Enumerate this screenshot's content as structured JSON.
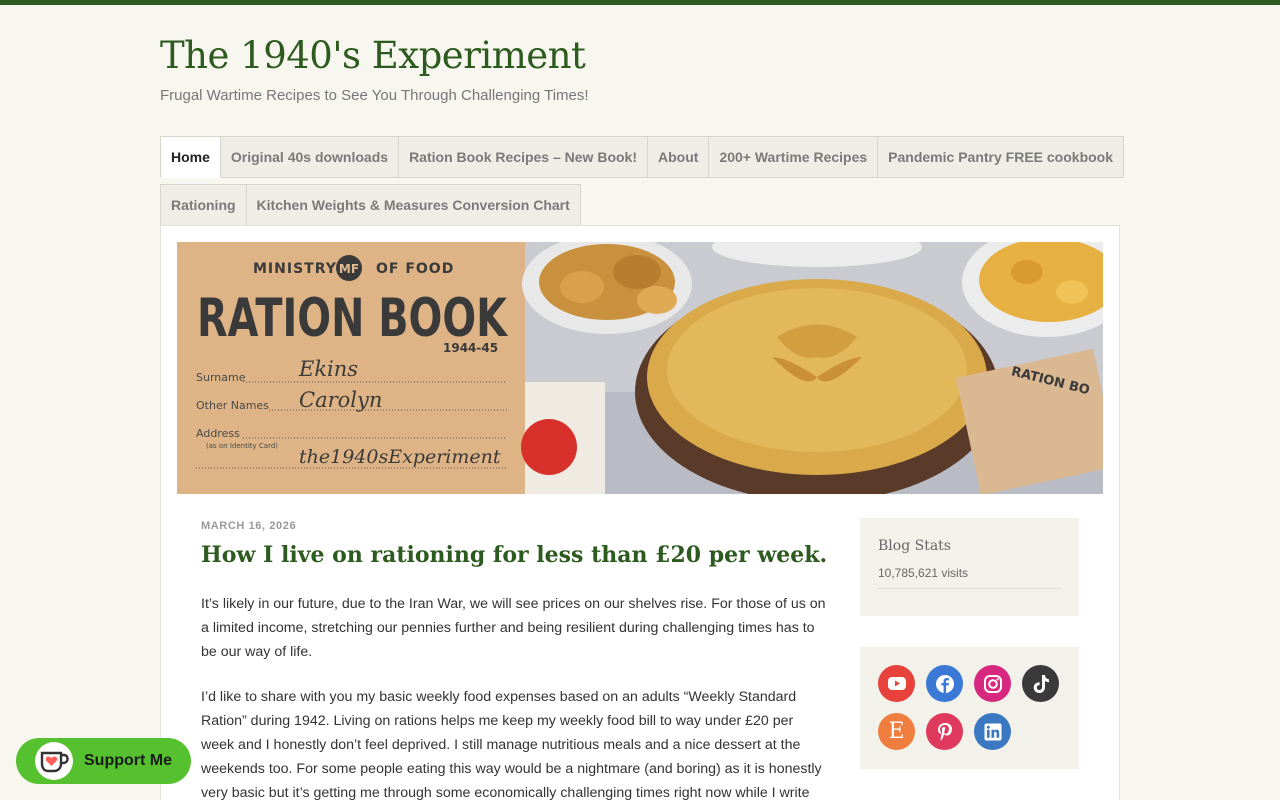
{
  "site": {
    "title": "The 1940's Experiment",
    "tagline": "Frugal Wartime Recipes to See You Through Challenging Times!"
  },
  "nav": {
    "row1": [
      {
        "label": "Home",
        "active": true
      },
      {
        "label": "Original 40s downloads"
      },
      {
        "label": "Ration Book Recipes – New Book!"
      },
      {
        "label": "About"
      },
      {
        "label": "200+ Wartime Recipes"
      },
      {
        "label": "Pandemic Pantry FREE cookbook"
      }
    ],
    "row2": [
      {
        "label": "Rationing"
      },
      {
        "label": "Kitchen Weights & Measures Conversion Chart"
      }
    ]
  },
  "header_image": {
    "ministry": "MINISTRY",
    "of_food": "OF FOOD",
    "logo": "MF",
    "title": "RATION BOOK",
    "year": "1944-45",
    "surname_label": "Surname",
    "surname_value": "Ekins",
    "other_names_label": "Other Names",
    "other_names_value": "Carolyn",
    "address_label": "Address",
    "address_sub": "(as on Identity Card)",
    "address_value": "the1940sExperiment",
    "book_fragment": "RATION BO"
  },
  "post": {
    "date": "MARCH 16, 2026",
    "title": "How I live on rationing for less than £20 per week.",
    "paragraphs": [
      "It’s likely in our future, due to the Iran War, we will see prices on our shelves rise. For those of us on a limited income, stretching our pennies further and being resilient during challenging times has to be our way of life.",
      "I’d like to share with you my basic weekly food expenses based on an adults “Weekly Standard Ration” during 1942. Living on rations helps me keep my weekly food bill to way under £20 per week and I honestly don’t feel deprived. I still manage nutritious meals and a nice dessert at the weekends too. For some people eating this way would be a nightmare (and boring) as it is honestly very basic but it’s getting me through some economically challenging times right now while I write"
    ]
  },
  "sidebar": {
    "stats_title": "Blog Stats",
    "stats_visits": "10,785,621 visits",
    "social": [
      {
        "name": "youtube-icon",
        "color": "#e8423d"
      },
      {
        "name": "facebook-icon",
        "color": "#3b79d6"
      },
      {
        "name": "instagram-icon",
        "color": "#d6287f"
      },
      {
        "name": "tiktok-icon",
        "color": "#3a3a3a"
      },
      {
        "name": "etsy-icon",
        "color": "#ef7e3f",
        "glyph": "E"
      },
      {
        "name": "pinterest-icon",
        "color": "#e0395e"
      },
      {
        "name": "linkedin-icon",
        "color": "#3b78c2"
      }
    ]
  },
  "support": {
    "label": "Support Me",
    "color": "#55c12e"
  }
}
